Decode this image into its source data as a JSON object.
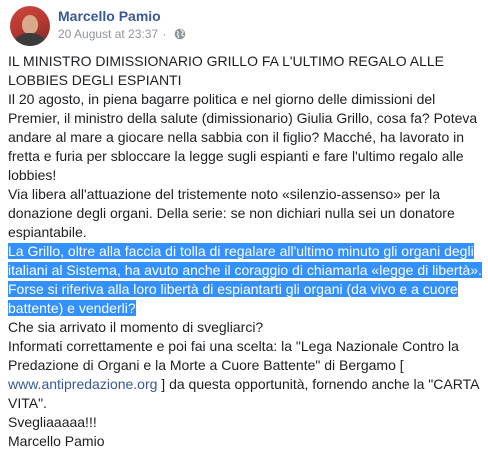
{
  "post": {
    "author": "Marcello Pamio",
    "timestamp": "20 August at 23:37",
    "separator": "·",
    "privacy_icon": "globe-icon",
    "body": {
      "title": "IL MINISTRO DIMISSIONARIO GRILLO FA L'ULTIMO REGALO ALLE LOBBIES DEGLI ESPIANTI",
      "paragraph_1": "Il 20 agosto, in piena bagarre politica e nel giorno delle dimissioni del Premier, il ministro della salute (dimissionario) Giulia Grillo, cosa fa? Poteva andare al mare a giocare nella sabbia con il figlio? Macché, ha lavorato in fretta e furia per sbloccare la legge sugli espianti e fare l'ultimo regalo alle lobbies!",
      "paragraph_2": "Via libera all'attuazione del tristemente noto «silenzio-assenso» per la donazione degli organi. Della serie: se non dichiari nulla sei un donatore espiantabile.",
      "highlighted": "La Grillo, oltre alla faccia di tolla di regalare all'ultimo minuto gli organi degli italiani al Sistema, ha avuto anche il coraggio di chiamarla «legge di libertà». Forse si riferiva alla loro libertà di espiantarti gli organi (da vivo e a cuore battente) e venderli?",
      "paragraph_3": "Che sia arrivato il momento di svegliarci?",
      "paragraph_4_before": "Informati correttamente e poi fai una scelta: la \"Lega Nazionale Contro la Predazione di Organi e la Morte a Cuore Battente\" di Bergamo [ ",
      "link_text": "www.antipredazione.org",
      "paragraph_4_after": " ] da questa opportunità, fornendo anche la \"CARTA VITA\".",
      "closing": "Svegliaaaaa!!!",
      "signature": "Marcello Pamio"
    }
  },
  "colors": {
    "author_name": "#385898",
    "meta_text": "#90949c",
    "body_text": "#1c1e21",
    "selection_bg": "#3390ff",
    "selection_text": "#ffffff",
    "link": "#385898"
  }
}
